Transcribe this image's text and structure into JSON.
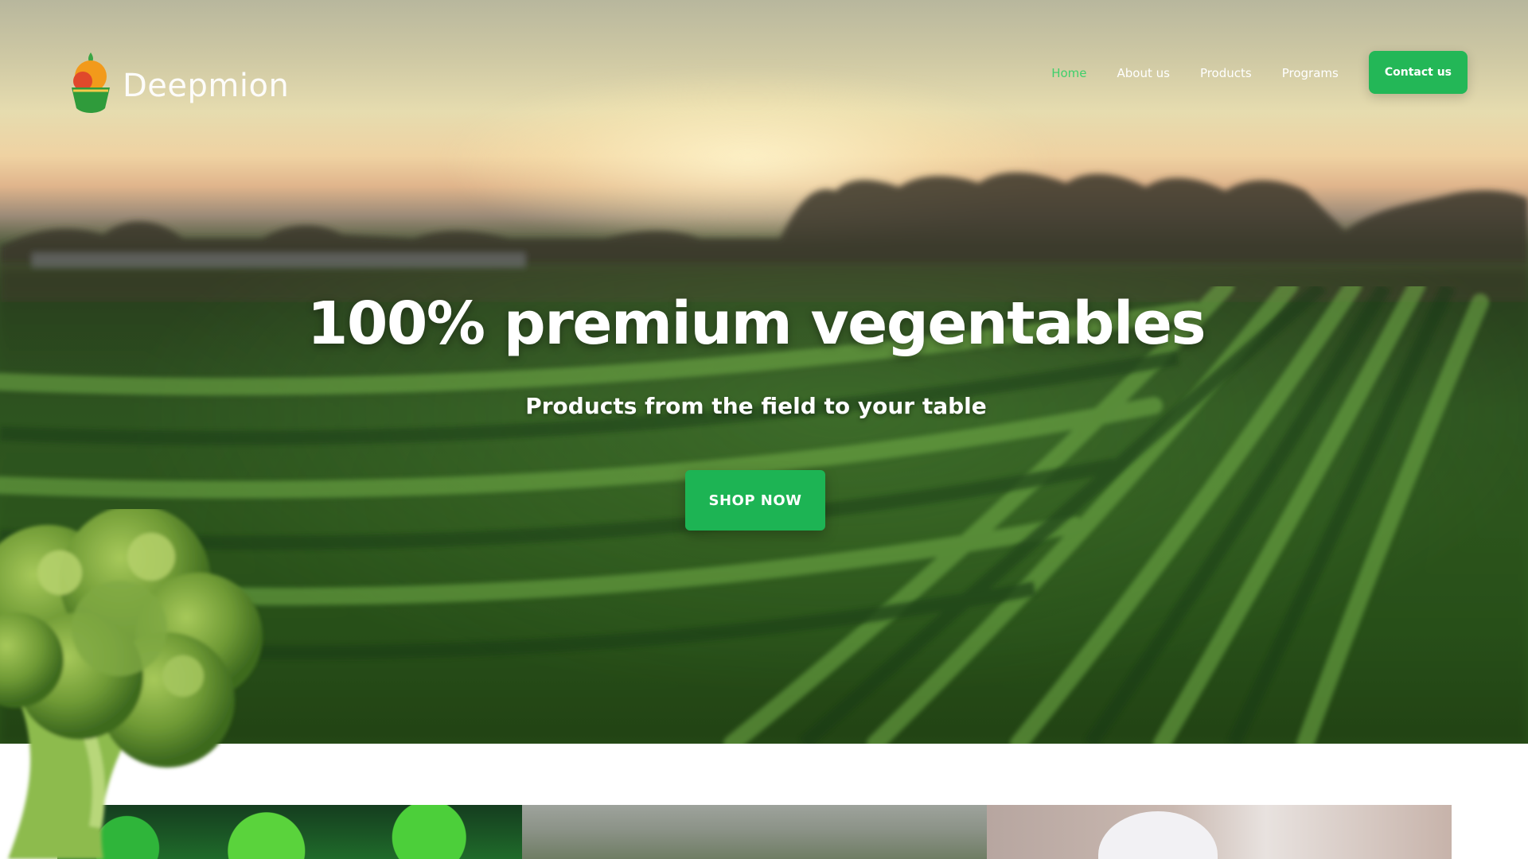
{
  "brand": {
    "name": "Deepmion",
    "colors": {
      "accent": "#23b757",
      "nav_active": "#3fd06b",
      "logo_orange": "#f29a1b",
      "logo_red": "#e0492b"
    }
  },
  "nav": {
    "items": [
      {
        "label": "Home",
        "active": true
      },
      {
        "label": "About us",
        "active": false
      },
      {
        "label": "Products",
        "active": false
      },
      {
        "label": "Programs",
        "active": false
      }
    ],
    "cta_label": "Contact us"
  },
  "hero": {
    "title": "100% premium vegentables",
    "subtitle": "Products from the field to your table",
    "cta_label": "SHOP NOW"
  },
  "icons": {
    "logo": "fruit-basket-logo-icon"
  }
}
